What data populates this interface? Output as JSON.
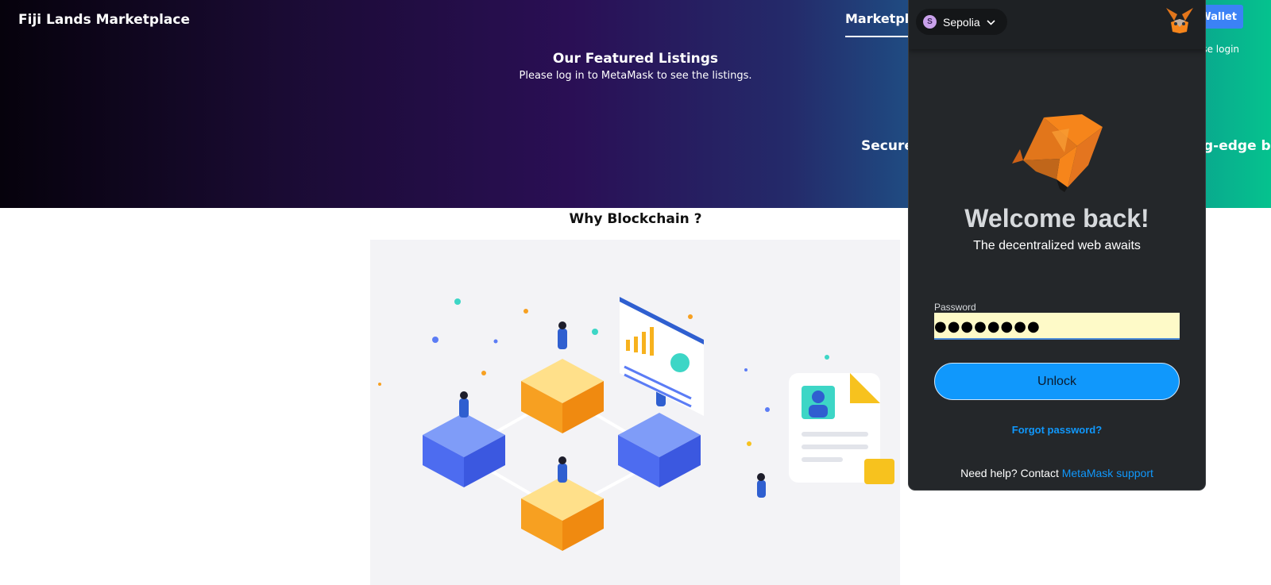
{
  "header": {
    "brand": "Fiji Lands Marketplace",
    "nav_marketplace": "Marketplace",
    "connect_button": "Wallet",
    "login_hint": "ase login",
    "featured_title": "Our Featured Listings",
    "featured_subtitle": "Please log in to MetaMask to see the listings.",
    "tagline_left": "Secure",
    "tagline_right": "g-edge bl"
  },
  "main": {
    "why_title": "Why Blockchain ?"
  },
  "metamask": {
    "network": "Sepolia",
    "network_initial": "S",
    "welcome": "Welcome back!",
    "tagline": "The decentralized web awaits",
    "password_label": "Password",
    "password_value": "●●●●●●●●",
    "unlock_label": "Unlock",
    "forgot_label": "Forgot password?",
    "help_text": "Need help? Contact ",
    "support_link": "MetaMask support"
  },
  "colors": {
    "accent_blue": "#1098fc",
    "popup_bg": "#24272a",
    "field_bg": "#fefac8",
    "fox_orange": "#f6851b"
  }
}
